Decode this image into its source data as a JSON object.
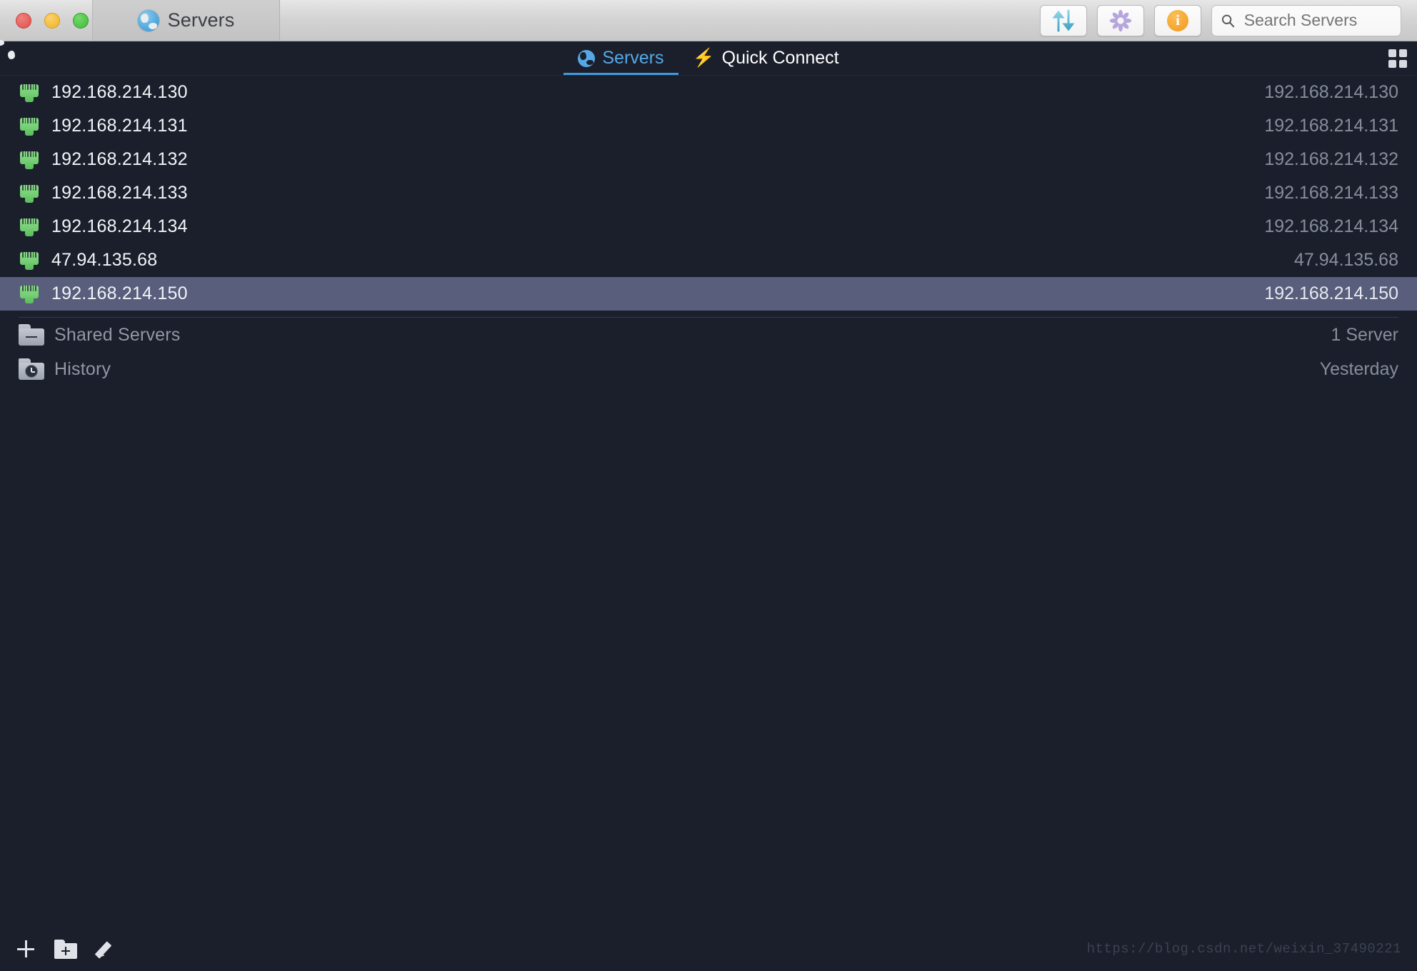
{
  "window": {
    "tab_title": "Servers",
    "traffic_lights": [
      "close-red",
      "minimize-yellow",
      "zoom-green"
    ]
  },
  "toolbar": {
    "transfer_label": "⇅",
    "transfer_name": "transfer-icon",
    "pinwheel_name": "pinwheel-icon",
    "info_label": "i",
    "search_placeholder": "Search Servers",
    "search_value": ""
  },
  "tabbar": {
    "left_icon": "globe-icon",
    "tabs": [
      {
        "label": "Servers",
        "icon": "globe-icon",
        "active": true
      },
      {
        "label": "Quick Connect",
        "icon": "bolt-icon",
        "active": false
      }
    ],
    "bolt_glyph": "⚡",
    "grid_icon": "grid-view-icon"
  },
  "servers": [
    {
      "name": "192.168.214.130",
      "value": "192.168.214.130",
      "selected": false
    },
    {
      "name": "192.168.214.131",
      "value": "192.168.214.131",
      "selected": false
    },
    {
      "name": "192.168.214.132",
      "value": "192.168.214.132",
      "selected": false
    },
    {
      "name": "192.168.214.133",
      "value": "192.168.214.133",
      "selected": false
    },
    {
      "name": "192.168.214.134",
      "value": "192.168.214.134",
      "selected": false
    },
    {
      "name": "47.94.135.68",
      "value": "47.94.135.68",
      "selected": false
    },
    {
      "name": "192.168.214.150",
      "value": "192.168.214.150",
      "selected": true
    }
  ],
  "folders": [
    {
      "name": "Shared Servers",
      "value": "1 Server",
      "icon": "shared-folder-icon"
    },
    {
      "name": "History",
      "value": "Yesterday",
      "icon": "history-folder-icon"
    }
  ],
  "bottombar": {
    "add_label": "+",
    "new_folder_name": "new-folder-icon",
    "edit_name": "edit-pencil-icon",
    "watermark": "https://blog.csdn.net/weixin_37490221"
  },
  "colors": {
    "background": "#1a1f2b",
    "selection": "#585e7b",
    "accent": "#3e9ae0",
    "server_icon": "#6cc96c",
    "muted_text": "#878d9c"
  }
}
